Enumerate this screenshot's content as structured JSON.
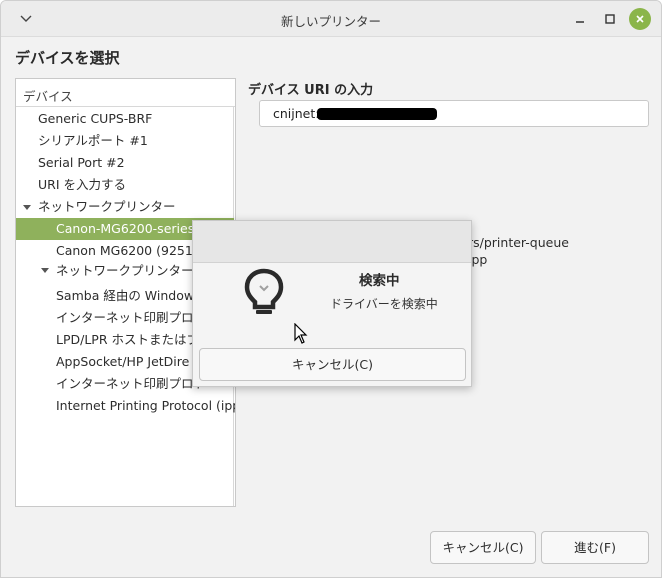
{
  "window": {
    "title": "新しいプリンター"
  },
  "heading": "デバイスを選択",
  "device_list": {
    "header": "デバイス",
    "items": [
      "Generic CUPS-BRF",
      "シリアルポート #1",
      "Serial Port #2",
      "URI を入力する",
      "ネットワークプリンター",
      "Canon-MG6200-series",
      "Canon MG6200 (9251",
      "ネットワークプリンターを",
      "Samba 経由の Window",
      "インターネット印刷プロト",
      "LPD/LPR ホストまたはプ",
      "AppSocket/HP JetDire",
      "インターネット印刷プロト",
      "Internet Printing Protocol (ipp"
    ]
  },
  "uri": {
    "label": "デバイス URI の入力",
    "value": "cnijnet:/"
  },
  "background_text": [
    "rs/printer-queue",
    "ipp"
  ],
  "popup": {
    "title": "検索中",
    "message": "ドライバーを検索中",
    "cancel_label": "キャンセル(C)"
  },
  "buttons": {
    "cancel": "キャンセル(C)",
    "next": "進む(F)"
  },
  "colors": {
    "selection": "#8fb15c",
    "close_button": "#8bb54a"
  }
}
